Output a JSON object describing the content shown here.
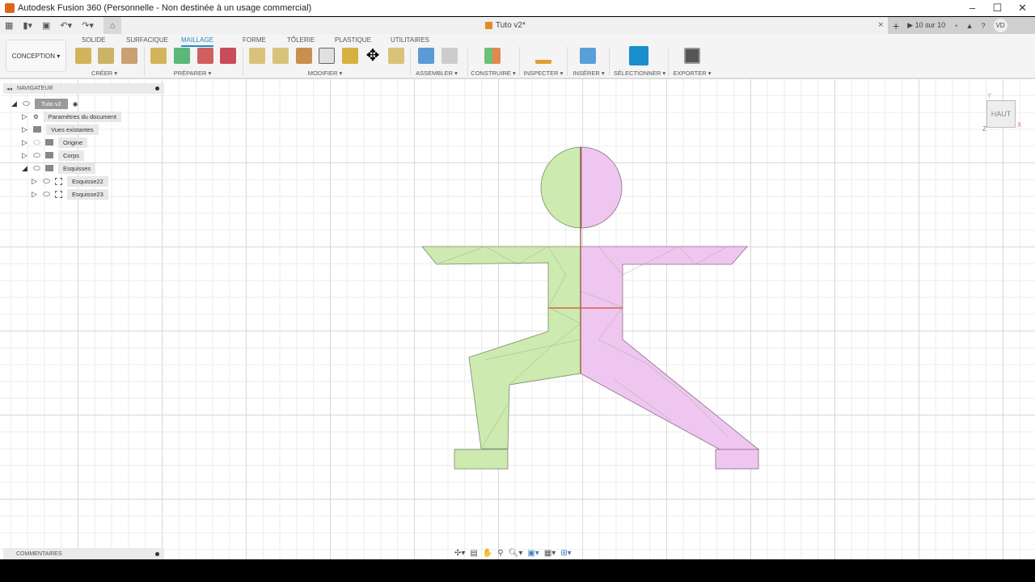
{
  "window": {
    "title": "Autodesk Fusion 360 (Personnelle - Non destinée à un usage commercial)",
    "minimize": "–",
    "maximize": "☐",
    "close": "✕"
  },
  "tabbar": {
    "doc_title": "Tuto v2*",
    "close_tab": "×",
    "new_tab": "+",
    "jobs": "10 sur 10",
    "avatar": "VD"
  },
  "ribbon": {
    "workspace": "CONCEPTION ▾",
    "tabs": [
      "SOLIDE",
      "SURFACIQUE",
      "MAILLAGE",
      "FORME",
      "TÔLERIE",
      "PLASTIQUE",
      "UTILITAIRES"
    ],
    "active_tab": "MAILLAGE",
    "groups": [
      "CRÉER ▾",
      "PRÉPARER ▾",
      "MODIFIER ▾",
      "ASSEMBLER ▾",
      "CONSTRUIRE ▾",
      "INSPECTER ▾",
      "INSÉRER ▾",
      "SÉLECTIONNER ▾",
      "EXPORTER ▾"
    ]
  },
  "navigator": {
    "title": "NAVIGATEUR",
    "root": "Tuto v2",
    "items": [
      "Paramètres du document",
      "Vues existantes",
      "Origine",
      "Corps",
      "Esquisses",
      "Esquisse22",
      "Esquisse23"
    ]
  },
  "comments": {
    "title": "COMMENTAIRES"
  },
  "viewcube": {
    "face": "HAUT",
    "x": "X",
    "y": "Y",
    "z": "Z"
  },
  "colors": {
    "accent": "#1a8fcd",
    "left_body": "#cdeab0",
    "right_body": "#efc6ef"
  }
}
